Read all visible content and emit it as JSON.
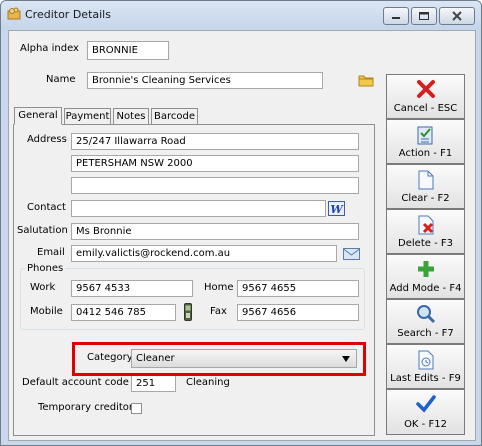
{
  "window": {
    "title": "Creditor Details"
  },
  "header": {
    "alpha_index_label": "Alpha index",
    "alpha_index_value": "BRONNIE",
    "name_label": "Name",
    "name_value": "Bronnie's Cleaning Services"
  },
  "tabs": [
    {
      "label": "General"
    },
    {
      "label": "Payment"
    },
    {
      "label": "Notes"
    },
    {
      "label": "Barcode"
    }
  ],
  "general": {
    "address_label": "Address",
    "address_line1": "25/247 Illawarra Road",
    "address_line2": "PETERSHAM NSW 2000",
    "address_line3": "",
    "contact_label": "Contact",
    "contact_value": "",
    "salutation_label": "Salutation",
    "salutation_value": "Ms Bronnie",
    "email_label": "Email",
    "email_value": "emily.valictis@rockend.com.au",
    "phones_label": "Phones",
    "work_label": "Work",
    "work_value": "9567 4533",
    "home_label": "Home",
    "home_value": "9567 4655",
    "mobile_label": "Mobile",
    "mobile_value": "0412 546 785",
    "fax_label": "Fax",
    "fax_value": "9567 4656",
    "category_label": "Category",
    "category_value": "Cleaner",
    "default_account_label": "Default account code",
    "default_account_value": "251",
    "default_account_name": "Cleaning",
    "temporary_creditor_label": "Temporary creditor",
    "temporary_creditor_checked": false
  },
  "actions": [
    {
      "label": "Cancel - ESC",
      "icon": "cancel-x-icon"
    },
    {
      "label": "Action - F1",
      "icon": "action-checklist-icon"
    },
    {
      "label": "Clear - F2",
      "icon": "clear-page-icon"
    },
    {
      "label": "Delete - F3",
      "icon": "delete-page-icon"
    },
    {
      "label": "Add Mode - F4",
      "icon": "add-plus-icon"
    },
    {
      "label": "Search - F7",
      "icon": "search-magnifier-icon"
    },
    {
      "label": "Last Edits - F9",
      "icon": "last-edits-icon"
    },
    {
      "label": "OK - F12",
      "icon": "ok-check-icon"
    }
  ],
  "colors": {
    "highlight_box": "#e00000",
    "ok_blue": "#1f5fd0",
    "cancel_red": "#d81e1e",
    "add_green": "#3aa33a"
  }
}
